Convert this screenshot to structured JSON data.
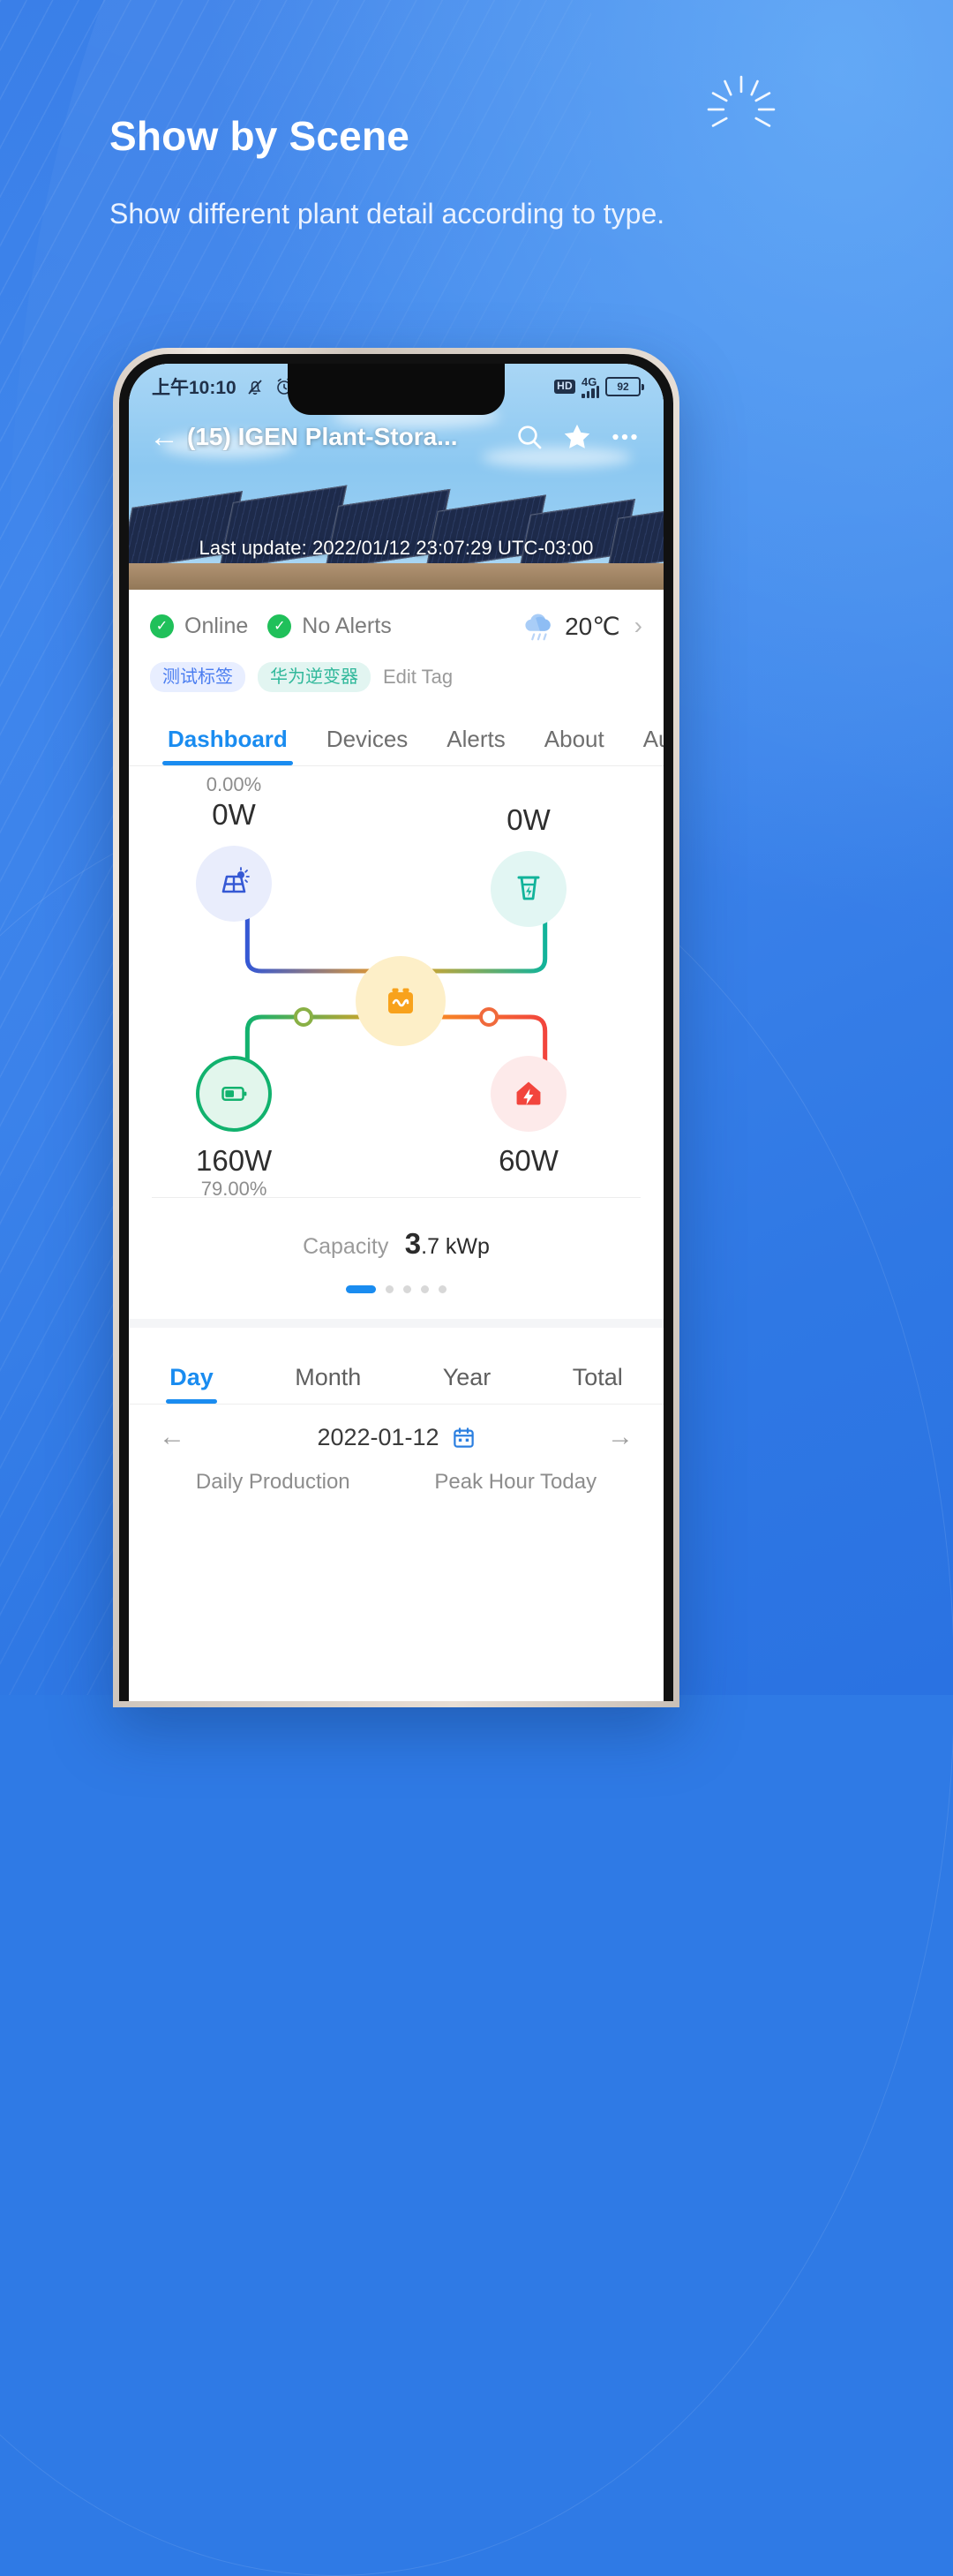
{
  "promo": {
    "title": "Show by Scene",
    "subtitle": "Show different plant detail according to type.",
    "sparkle_icon": "sparkle-burst-icon"
  },
  "phone": {
    "statusbar": {
      "time": "上午10:10",
      "mute_icon": "bell-muted-icon",
      "alarm_icon": "alarm-clock-icon",
      "hd_badge": "HD",
      "network": "4G",
      "signal_icon": "signal-bars-icon",
      "battery_level": "92"
    },
    "navbar": {
      "back_icon": "arrow-left-icon",
      "title": "(15) IGEN Plant-Stora...",
      "search_icon": "search-icon",
      "favorite_icon": "star-filled-icon",
      "more_icon": "more-horizontal-icon"
    },
    "hero": {
      "last_update": "Last update: 2022/01/12 23:07:29 UTC-03:00"
    },
    "info": {
      "status_online": "Online",
      "status_alerts": "No Alerts",
      "online_check_icon": "check-circle-icon",
      "alerts_check_icon": "check-circle-icon",
      "weather_icon": "rain-cloud-icon",
      "temperature": "20℃",
      "weather_chevron": "chevron-right-icon",
      "tags": [
        {
          "label": "测试标签",
          "style": "blue"
        },
        {
          "label": "华为逆变器",
          "style": "teal"
        }
      ],
      "edit_tag": "Edit Tag"
    },
    "tabs": [
      {
        "label": "Dashboard",
        "active": true
      },
      {
        "label": "Devices",
        "active": false
      },
      {
        "label": "Alerts",
        "active": false
      },
      {
        "label": "About",
        "active": false
      },
      {
        "label": "Aut",
        "active": false
      }
    ],
    "flow": {
      "solar": {
        "percent": "0.00%",
        "value": "0W",
        "icon": "solar-panel-icon",
        "color": "#3558d4"
      },
      "grid": {
        "value": "0W",
        "icon": "grid-tower-icon",
        "color": "#12b39a"
      },
      "battery": {
        "value": "160W",
        "percent": "79.00%",
        "icon": "battery-icon",
        "color": "#12b26e"
      },
      "load": {
        "value": "60W",
        "icon": "home-bolt-icon",
        "color": "#f2453d"
      },
      "inverter": {
        "icon": "inverter-icon",
        "color": "#f8a21c"
      }
    },
    "capacity": {
      "label": "Capacity",
      "value": "3",
      "unit": ".7 kWp"
    },
    "pager": {
      "total": 5,
      "active_index": 0
    },
    "periods": [
      {
        "label": "Day",
        "active": true
      },
      {
        "label": "Month",
        "active": false
      },
      {
        "label": "Year",
        "active": false
      },
      {
        "label": "Total",
        "active": false
      }
    ],
    "datebar": {
      "prev_icon": "arrow-left-icon",
      "date": "2022-01-12",
      "calendar_icon": "calendar-icon",
      "next_icon": "arrow-right-icon"
    },
    "cut_labels": [
      "Daily Production",
      "Peak Hour Today"
    ]
  },
  "colors": {
    "brand_blue": "#1a8cf0",
    "page_blue": "#3a7fe8",
    "green": "#20c05a",
    "orange": "#f8a21c",
    "red": "#f2453d"
  }
}
